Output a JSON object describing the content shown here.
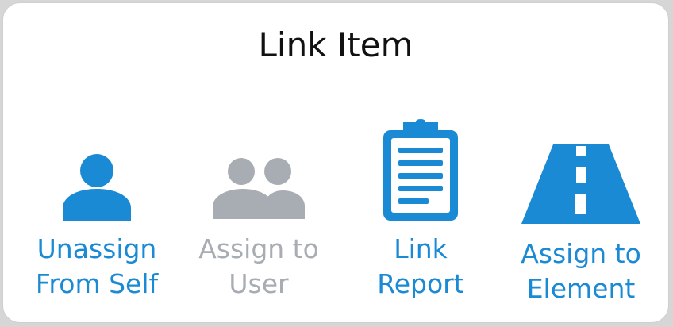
{
  "dialog": {
    "title": "Link Item"
  },
  "actions": [
    {
      "label": "Unassign\nFrom Self",
      "icon": "person-icon",
      "state": "enabled"
    },
    {
      "label": "Assign to\nUser",
      "icon": "people-icon",
      "state": "disabled"
    },
    {
      "label": "Link\nReport",
      "icon": "clipboard-icon",
      "state": "enabled"
    },
    {
      "label": "Assign to\nElement",
      "icon": "road-icon",
      "state": "enabled"
    }
  ],
  "colors": {
    "accent": "#1a8ad4",
    "disabled": "#a7adb3",
    "title": "#111111"
  }
}
